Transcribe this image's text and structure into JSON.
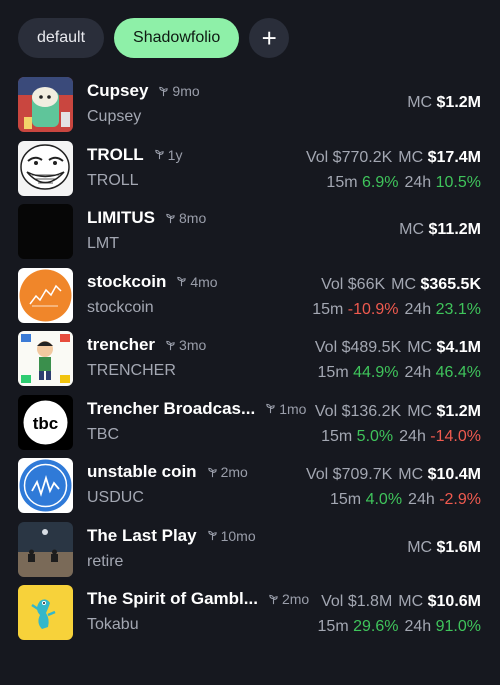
{
  "tabs": [
    {
      "label": "default",
      "active": false
    },
    {
      "label": "Shadowfolio",
      "active": true
    },
    {
      "label": "+",
      "icon": "plus-icon"
    }
  ],
  "colors": {
    "positive": "#3fc45b",
    "negative": "#ef5a4f",
    "accent": "#8ef0a8"
  },
  "rows": [
    {
      "name": "Cupsey",
      "age": "9mo",
      "ticker": "Cupsey",
      "mc": "$1.2M"
    },
    {
      "name": "TROLL",
      "age": "1y",
      "ticker": "TROLL",
      "vol": "$770.2K",
      "mc": "$17.4M",
      "m15": "6.9%",
      "h24": "10.5%"
    },
    {
      "name": "LIMITUS",
      "age": "8mo",
      "ticker": "LMT",
      "mc": "$11.2M"
    },
    {
      "name": "stockcoin",
      "age": "4mo",
      "ticker": "stockcoin",
      "vol": "$66K",
      "mc": "$365.5K",
      "m15": "-10.9%",
      "h24": "23.1%"
    },
    {
      "name": "trencher",
      "age": "3mo",
      "ticker": "TRENCHER",
      "vol": "$489.5K",
      "mc": "$4.1M",
      "m15": "44.9%",
      "h24": "46.4%"
    },
    {
      "name": "Trencher Broadcas...",
      "age": "1mo",
      "ticker": "TBC",
      "vol": "$136.2K",
      "mc": "$1.2M",
      "m15": "5.0%",
      "h24": "-14.0%"
    },
    {
      "name": "unstable coin",
      "age": "2mo",
      "ticker": "USDUC",
      "vol": "$709.7K",
      "mc": "$10.4M",
      "m15": "4.0%",
      "h24": "-2.9%"
    },
    {
      "name": "The Last Play",
      "age": "10mo",
      "ticker": "retire",
      "mc": "$1.6M"
    },
    {
      "name": "The Spirit of Gambl...",
      "age": "2mo",
      "ticker": "Tokabu",
      "vol": "$1.8M",
      "mc": "$10.6M",
      "m15": "29.6%",
      "h24": "91.0%"
    }
  ],
  "labels": {
    "vol": "Vol",
    "mc": "MC",
    "m15": "15m",
    "h24": "24h"
  },
  "avatar_text": {
    "tbc": "tbc"
  }
}
